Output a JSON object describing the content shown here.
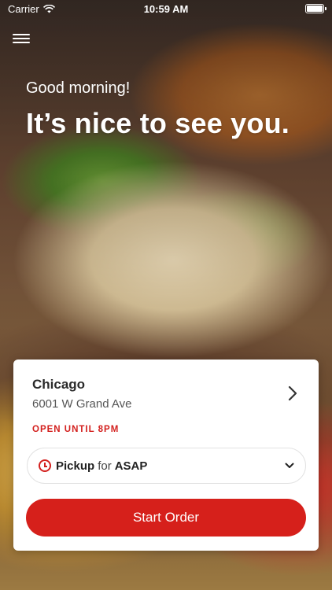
{
  "status_bar": {
    "carrier": "Carrier",
    "time": "10:59 AM"
  },
  "hero": {
    "greeting": "Good morning!",
    "headline": "It’s nice to see you."
  },
  "location": {
    "city": "Chicago",
    "address": "6001 W Grand Ave",
    "hours": "OPEN UNTIL 8PM"
  },
  "order_select": {
    "mode": "Pickup",
    "connector": "for",
    "time": "ASAP"
  },
  "actions": {
    "start_order": "Start Order"
  },
  "icons": {
    "menu": "hamburger-menu-icon",
    "wifi": "wifi-icon",
    "battery": "battery-icon",
    "location_chevron": "chevron-right-icon",
    "clock": "clock-icon",
    "dropdown": "chevron-down-icon"
  },
  "colors": {
    "accent": "#d6201b",
    "hours_text": "#d3201e"
  }
}
